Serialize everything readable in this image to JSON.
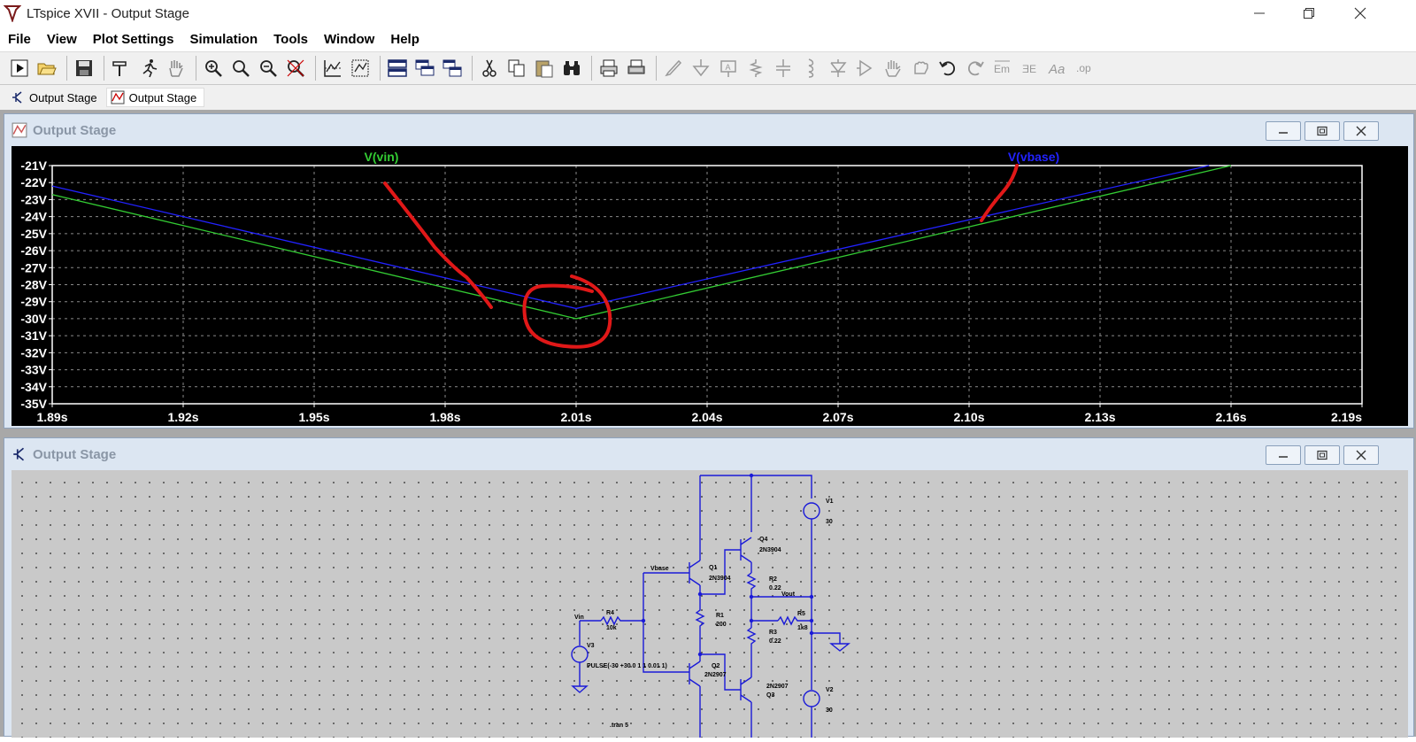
{
  "window": {
    "title": "LTspice XVII - Output Stage"
  },
  "menu": {
    "items": [
      "File",
      "View",
      "Plot Settings",
      "Simulation",
      "Tools",
      "Window",
      "Help"
    ]
  },
  "tabs": [
    {
      "label": "Output Stage",
      "icon": "schematic-icon"
    },
    {
      "label": "Output Stage",
      "icon": "waveform-icon"
    }
  ],
  "plot_window": {
    "title": "Output Stage"
  },
  "schematic_window": {
    "title": "Output Stage"
  },
  "colors": {
    "vin": "#33cc33",
    "vbase": "#2222ff",
    "annotation": "#e01818",
    "wire": "#1a1ad8"
  },
  "chart_data": {
    "type": "line",
    "xlabel": "",
    "ylabel": "",
    "x_ticks": [
      "1.89s",
      "1.92s",
      "1.95s",
      "1.98s",
      "2.01s",
      "2.04s",
      "2.07s",
      "2.10s",
      "2.13s",
      "2.16s",
      "2.19s"
    ],
    "y_ticks": [
      "-21V",
      "-22V",
      "-23V",
      "-24V",
      "-25V",
      "-26V",
      "-27V",
      "-28V",
      "-29V",
      "-30V",
      "-31V",
      "-32V",
      "-33V",
      "-34V",
      "-35V"
    ],
    "xlim": [
      1.89,
      2.19
    ],
    "ylim": [
      -35,
      -21
    ],
    "grid": true,
    "series": [
      {
        "name": "V(vin)",
        "color": "#33cc33",
        "x": [
          1.89,
          2.01,
          2.16
        ],
        "y": [
          -22.7,
          -30.0,
          -21.0
        ]
      },
      {
        "name": "V(vbase)",
        "color": "#2222ff",
        "x": [
          1.89,
          2.01,
          2.155
        ],
        "y": [
          -22.2,
          -29.4,
          -21.0
        ]
      }
    ]
  },
  "schematic": {
    "labels": {
      "vin": "Vin",
      "vbase": "Vbase",
      "vout": "Vout",
      "r4": "R4",
      "r4v": "10k",
      "v3": "V3",
      "pulse": "PULSE(-30 +30 0 1 1 0.01 1)",
      "q1": "Q1",
      "q1m": "2N3904",
      "q2": "Q2",
      "q2m": "2N2907",
      "q3": "Q3",
      "q3m": "2N2907",
      "q4": "Q4",
      "q4m": "2N3904",
      "r1": "R1",
      "r1v": "200",
      "r2": "R2",
      "r2v": "0.22",
      "r3": "R3",
      "r3v": "0.22",
      "r5": "R5",
      "r5v": "1k8",
      "v1": "V1",
      "v1v": "30",
      "v2": "V2",
      "v2v": "30",
      "tran": ".tran 5"
    }
  }
}
